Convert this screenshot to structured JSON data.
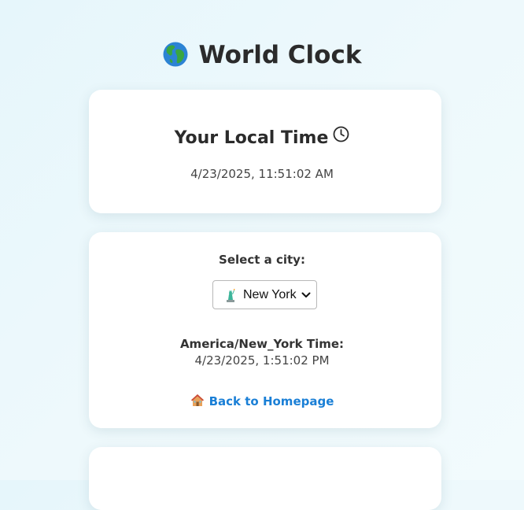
{
  "header": {
    "title": "World Clock",
    "icon": "globe-icon"
  },
  "local_card": {
    "heading": "Your Local Time",
    "heading_icon": "clock-icon",
    "time": "4/23/2025, 11:51:02 AM"
  },
  "city_card": {
    "select_label": "Select a city:",
    "selected_city": "New York",
    "selected_city_icon": "statue-of-liberty-icon",
    "timezone_label": "America/New_York Time:",
    "timezone_time": "4/23/2025, 1:51:02 PM",
    "back_link_label": "Back to Homepage",
    "back_link_icon": "house-icon"
  },
  "colors": {
    "link": "#1a7fd6",
    "text": "#333333",
    "card": "#ffffff",
    "background": "#e6f6fb"
  }
}
